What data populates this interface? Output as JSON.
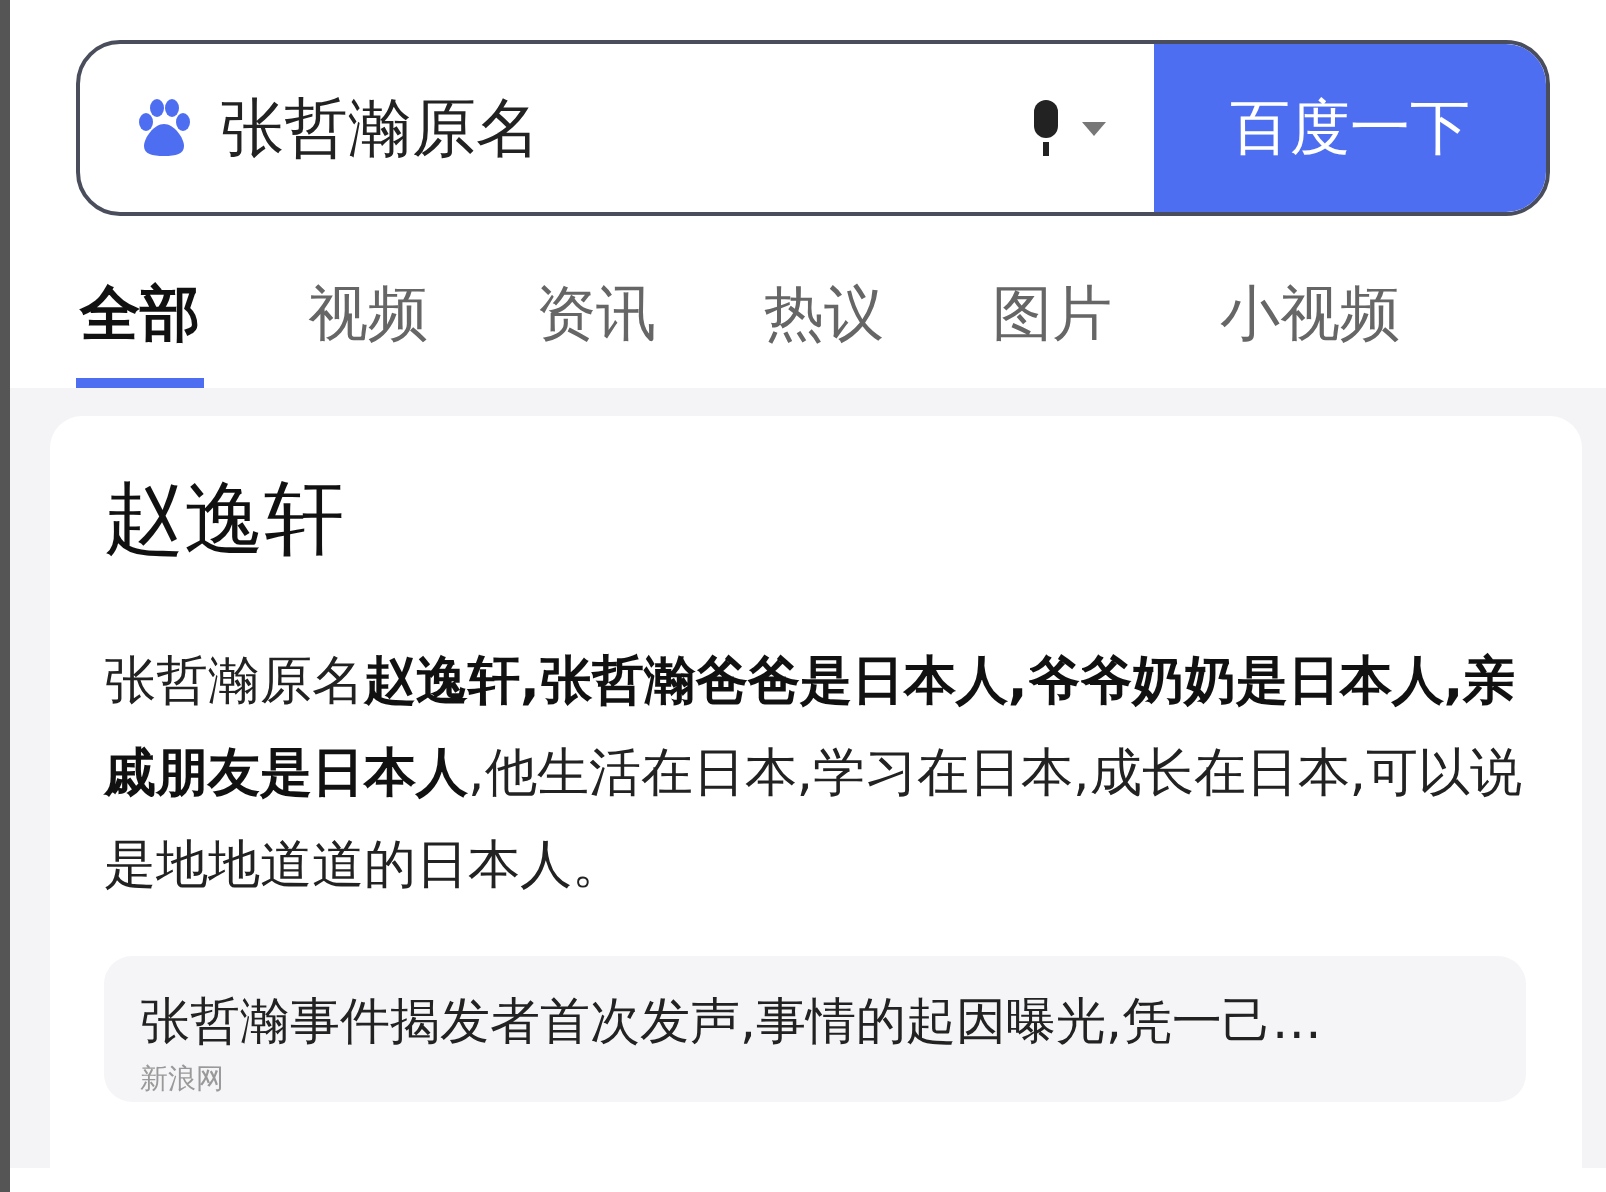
{
  "search": {
    "query": "张哲瀚原名",
    "button": "百度一下"
  },
  "tabs": [
    {
      "label": "全部",
      "selected": true
    },
    {
      "label": "视频",
      "selected": false
    },
    {
      "label": "资讯",
      "selected": false
    },
    {
      "label": "热议",
      "selected": false
    },
    {
      "label": "图片",
      "selected": false
    },
    {
      "label": "小视频",
      "selected": false
    }
  ],
  "result": {
    "title": "赵逸轩",
    "text": "张哲瀚原名**赵逸轩,张哲瀚爸爸是日本人,爷爷奶奶是日本人,亲戚朋友是日本人**,他生活在日本,学习在日本,成长在日本,可以说是地地道道的日本人。",
    "related": {
      "title": "张哲瀚事件揭发者首次发声,事情的起因曝光,凭一己…",
      "source": "新浪网"
    }
  }
}
